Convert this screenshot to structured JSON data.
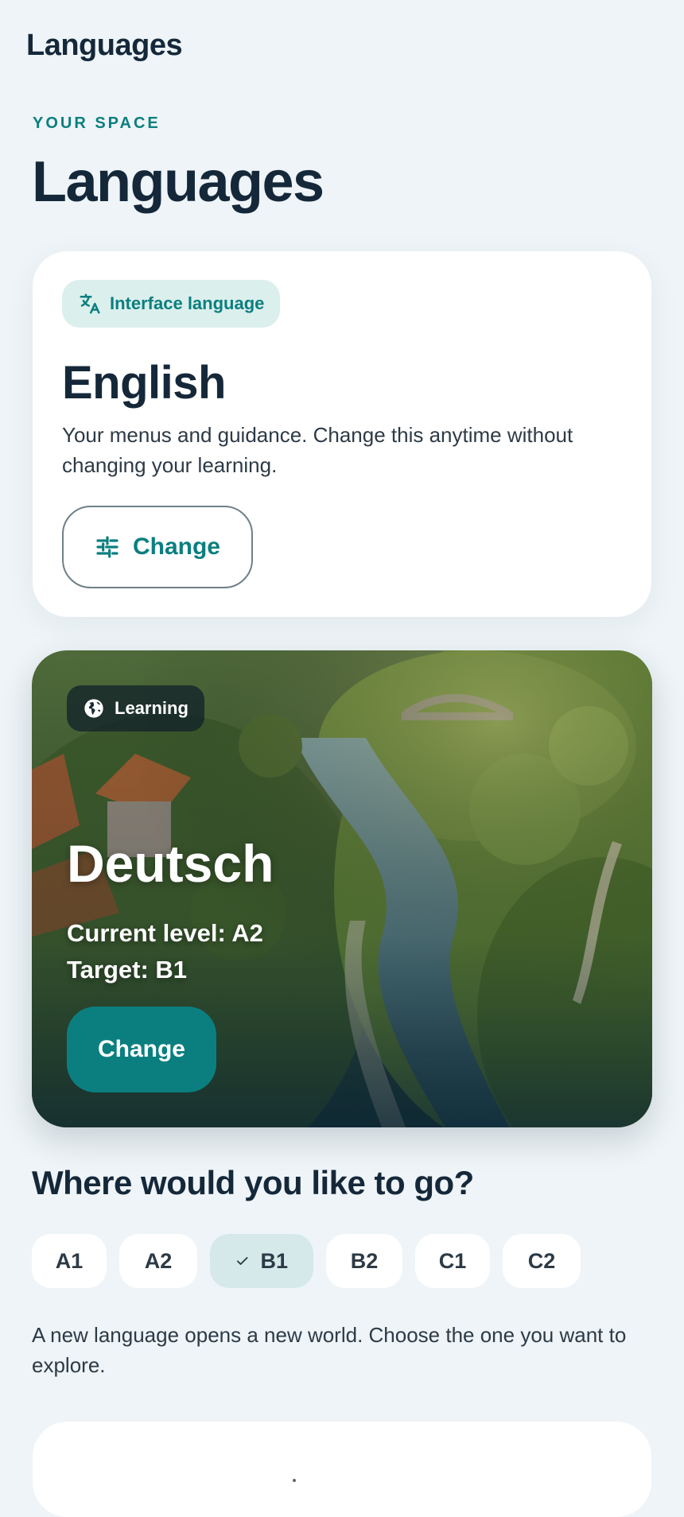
{
  "topbar": {
    "title": "Languages"
  },
  "header": {
    "eyebrow": "YOUR SPACE",
    "title": "Languages"
  },
  "interface_card": {
    "chip_label": "Interface language",
    "chip_icon": "translate-icon",
    "language": "English",
    "description": "Your menus and guidance. Change this anytime without changing your learning.",
    "change_label": "Change",
    "change_icon": "tune-icon"
  },
  "learning_card": {
    "chip_label": "Learning",
    "chip_icon": "globe-icon",
    "language": "Deutsch",
    "current_level": "Current level: A2",
    "target": "Target: B1",
    "change_label": "Change"
  },
  "level_picker": {
    "question": "Where would you like to go?",
    "levels": [
      {
        "label": "A1",
        "selected": false
      },
      {
        "label": "A2",
        "selected": false
      },
      {
        "label": "B1",
        "selected": true
      },
      {
        "label": "B2",
        "selected": false
      },
      {
        "label": "C1",
        "selected": false
      },
      {
        "label": "C2",
        "selected": false
      }
    ],
    "selected_icon": "check-icon"
  },
  "tagline": "A new language opens a new world. Choose the one you want to explore.",
  "colors": {
    "accent": "#0b7f80",
    "background": "#eef4f7",
    "text": "#15283a",
    "chip_bg": "#dbefed",
    "selected_bg": "#d5e9ea"
  }
}
